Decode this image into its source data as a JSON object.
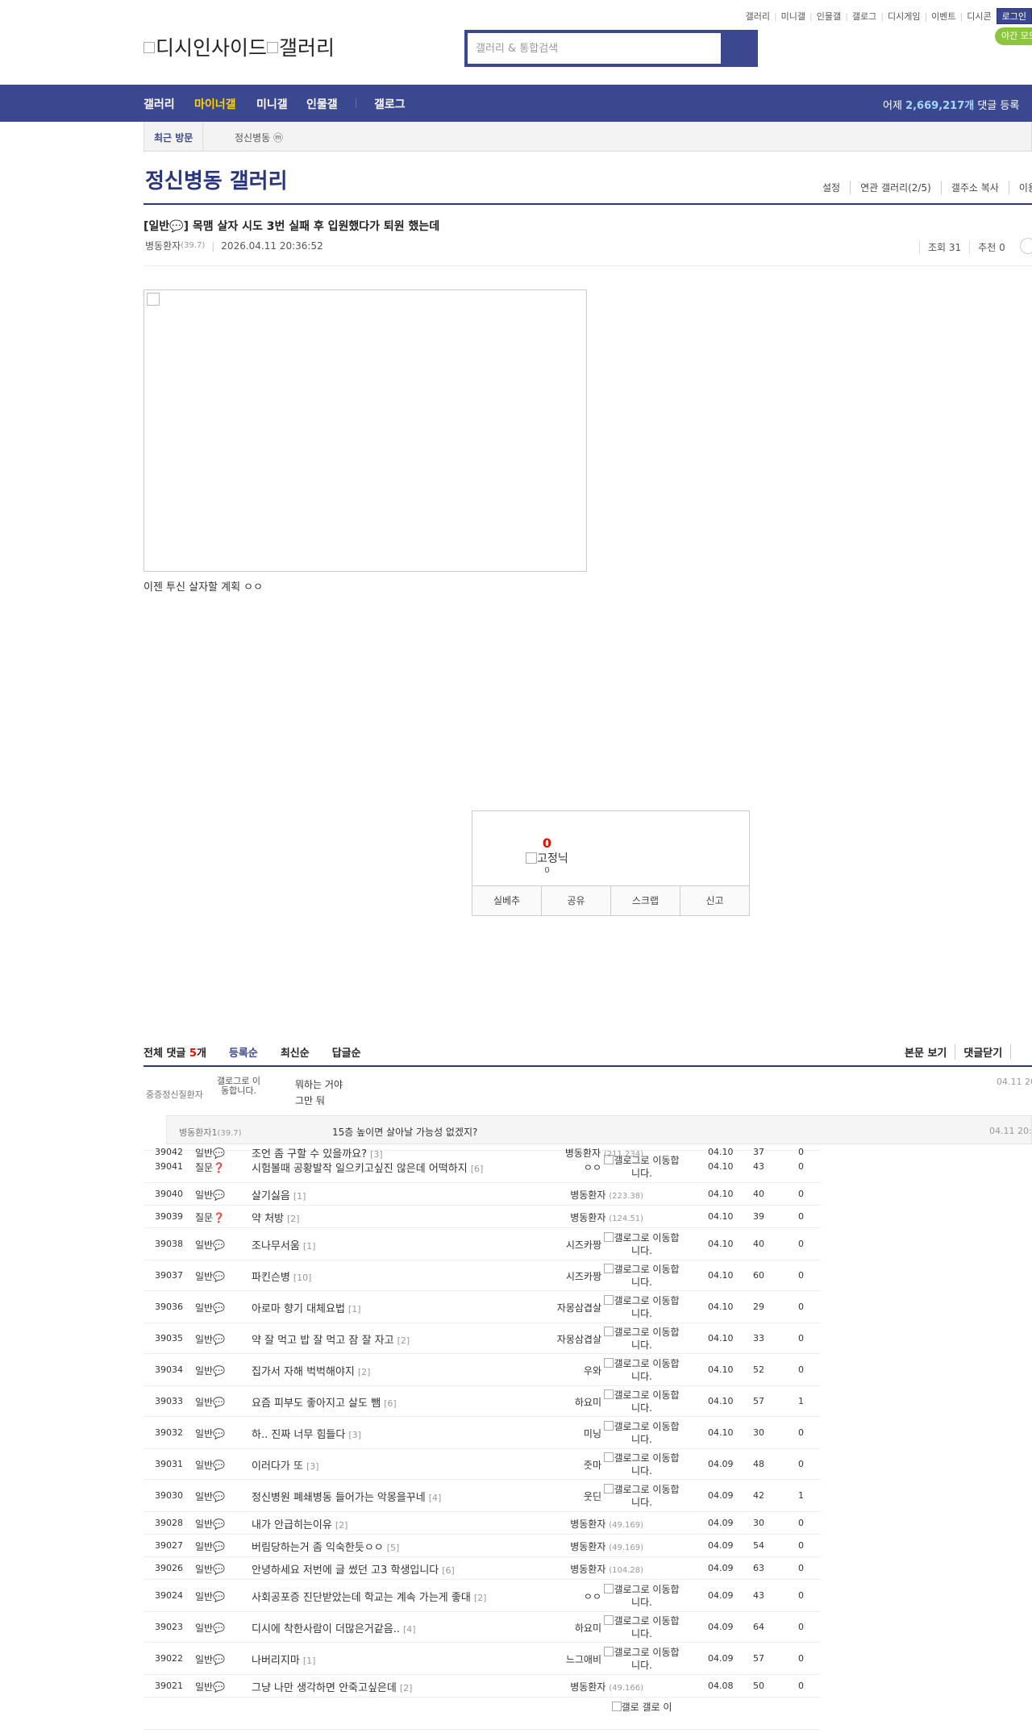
{
  "util": {
    "links": [
      "갤러리",
      "미니갤",
      "인물갤",
      "갤로그",
      "디시게임",
      "이벤트",
      "디시콘"
    ],
    "login": "로그인",
    "night": "야간 모드"
  },
  "logo": {
    "alt1": "디시인사이드",
    "alt2": "갤러리"
  },
  "search": {
    "placeholder": "갤러리 & 통합검색"
  },
  "gnb": {
    "items": [
      "갤러리",
      "마이너갤",
      "미니갤",
      "인물갤",
      "갤로그"
    ],
    "active_index": 1,
    "comment_prefix": "어제 ",
    "comment_count": "2,669,217개",
    "comment_suffix": " 댓글 등록"
  },
  "visit": {
    "label": "최근 방문",
    "gallery": "정신병동 ⓜ"
  },
  "gallery": {
    "title": "정신병동 갤러리",
    "options": [
      "설정",
      "연관 갤러리(2/5)",
      "갤주소 복사",
      "이용"
    ]
  },
  "post": {
    "title": "[일반💬] 목맴 살자 시도 3번 실패 후 입원했다가 퇴원 했는데",
    "author": "병동환자",
    "ip": "(39.7)",
    "date": "2026.04.11 20:36:52",
    "views": "조회 31",
    "recommends": "추천 0",
    "body": "이젠 투신 살자할 계획 ㅇㅇ"
  },
  "recommend": {
    "count": "0",
    "fixed_alt": "고정닉",
    "fixed_count": "0",
    "buttons": [
      "실베추",
      "공유",
      "스크랩",
      "신고"
    ]
  },
  "comments": {
    "total_label": "전체 댓글 ",
    "total_count": "5",
    "total_unit": "개",
    "tabs": [
      "등록순",
      "최신순",
      "답글순"
    ],
    "right": [
      "본문 보기",
      "댓글닫기",
      ""
    ],
    "items": [
      {
        "nick": "중증정신질환자",
        "gallog": "갤로그로 이동합니다.",
        "text1": "뭐하는 거야",
        "text2": "그만 둬",
        "date": "04.11 20"
      },
      {
        "nick": "병동환자1",
        "ip": "(39.7)",
        "text": "15층 높이면 살아날 가능성 없겠지?",
        "date": "04.11 20:4"
      }
    ]
  },
  "list": [
    {
      "no": "39042",
      "sub": "일반💬",
      "title": "조언 좀 구할 수 있을까요?",
      "rc": "[3]",
      "writer": "병동환자",
      "ip": "(211.234)",
      "date": "04.10",
      "views": "37",
      "rec": "0",
      "h": 18,
      "partial": true
    },
    {
      "no": "39041",
      "sub": "질문❓",
      "title": "시험볼때 공황발작 일으키고싶진 않은데 어떡하지",
      "rc": "[6]",
      "writer": "ㅇㅇ",
      "gallog": "갤로그로 이동합니다.",
      "date": "04.10",
      "views": "43",
      "rec": "0",
      "h": 40
    },
    {
      "no": "39040",
      "sub": "일반💬",
      "title": "살기싫음",
      "rc": "[1]",
      "writer": "병동환자",
      "ip": "(223.38)",
      "date": "04.10",
      "views": "40",
      "rec": "0",
      "h": 28
    },
    {
      "no": "39039",
      "sub": "질문❓",
      "title": "약 처방",
      "rc": "[2]",
      "writer": "병동환자",
      "ip": "(124.51)",
      "date": "04.10",
      "views": "39",
      "rec": "0",
      "h": 28
    },
    {
      "no": "39038",
      "sub": "일반💬",
      "title": "조나무서움",
      "rc": "[1]",
      "writer": "시즈카짱",
      "gallog": "갤로그로 이동합니다.",
      "date": "04.10",
      "views": "40",
      "rec": "0",
      "h": 40
    },
    {
      "no": "39037",
      "sub": "일반💬",
      "title": "파킨슨병",
      "rc": "[10]",
      "writer": "시즈카짱",
      "gallog": "갤로그로 이동합니다.",
      "date": "04.10",
      "views": "60",
      "rec": "0",
      "h": 38
    },
    {
      "no": "39036",
      "sub": "일반💬",
      "title": "아로마 향기 대체요법",
      "rc": "[1]",
      "writer": "자몽삼겹살",
      "gallog": "갤로그로 이동합니다.",
      "date": "04.10",
      "views": "29",
      "rec": "0",
      "h": 40
    },
    {
      "no": "39035",
      "sub": "일반💬",
      "title": "약 잘 먹고 밥 잘 먹고 잠 잘 자고",
      "rc": "[2]",
      "writer": "자몽삼겹살",
      "gallog": "갤로그로 이동합니다.",
      "date": "04.10",
      "views": "33",
      "rec": "0",
      "h": 38
    },
    {
      "no": "39034",
      "sub": "일반💬",
      "title": "집가서 자해 벅벅해야지",
      "rc": "[2]",
      "writer": "우와",
      "gallog": "갤로그로 이동합니다.",
      "date": "04.10",
      "views": "52",
      "rec": "0",
      "h": 40
    },
    {
      "no": "39033",
      "sub": "일반💬",
      "title": "요즘 피부도 좋아지고 살도 뺌",
      "rc": "[6]",
      "writer": "하요미",
      "gallog": "갤로그로 이동합니다.",
      "date": "04.10",
      "views": "57",
      "rec": "1",
      "h": 38
    },
    {
      "no": "39032",
      "sub": "일반💬",
      "title": "하.. 진짜 너무 힘들다",
      "rc": "[3]",
      "writer": "미닝",
      "gallog": "갤로그로 이동합니다.",
      "date": "04.10",
      "views": "30",
      "rec": "0",
      "h": 40
    },
    {
      "no": "39031",
      "sub": "일반💬",
      "title": "이러다가 또",
      "rc": "[3]",
      "writer": "줏마",
      "gallog": "갤로그로 이동합니다.",
      "date": "04.09",
      "views": "48",
      "rec": "0",
      "h": 38
    },
    {
      "no": "39030",
      "sub": "일반💬",
      "title": "정신병원 폐쇄병동 들어가는 악몽을꾸네",
      "rc": "[4]",
      "writer": "웃딘",
      "gallog": "갤로그로 이동합니다.",
      "date": "04.09",
      "views": "42",
      "rec": "1",
      "h": 40
    },
    {
      "no": "39028",
      "sub": "일반💬",
      "title": "내가 안급히는이유",
      "rc": "[2]",
      "writer": "병동환자",
      "ip": "(49.169)",
      "date": "04.09",
      "views": "30",
      "rec": "0",
      "h": 28
    },
    {
      "no": "39027",
      "sub": "일반💬",
      "title": "버림당하는거 좀 익숙한듯ㅇㅇ",
      "rc": "[5]",
      "writer": "병동환자",
      "ip": "(49.169)",
      "date": "04.09",
      "views": "54",
      "rec": "0",
      "h": 28
    },
    {
      "no": "39026",
      "sub": "일반💬",
      "title": "안녕하세요 저번에 글 썼던 고3 학생입니다",
      "rc": "[6]",
      "writer": "병동환자",
      "ip": "(104.28)",
      "date": "04.09",
      "views": "63",
      "rec": "0",
      "h": 28
    },
    {
      "no": "39024",
      "sub": "일반💬",
      "title": "사회공포증 진단받았는데 학교는 계속 가는게 좋대",
      "rc": "[2]",
      "writer": "ㅇㅇ",
      "gallog": "갤로그로 이동합니다.",
      "date": "04.09",
      "views": "43",
      "rec": "0",
      "h": 40
    },
    {
      "no": "39023",
      "sub": "일반💬",
      "title": "디시에 착한사람이 더많은거같음..",
      "rc": "[4]",
      "writer": "하요미",
      "gallog": "갤로그로 이동합니다.",
      "date": "04.09",
      "views": "64",
      "rec": "0",
      "h": 38
    },
    {
      "no": "39022",
      "sub": "일반💬",
      "title": "나버리지마",
      "rc": "[1]",
      "writer": "느그애비",
      "gallog": "갤로그로 이동합니다.",
      "date": "04.09",
      "views": "57",
      "rec": "0",
      "h": 40
    },
    {
      "no": "39021",
      "sub": "일반💬",
      "title": "그냥 나만 생각하면 안죽고싶은데",
      "rc": "[2]",
      "writer": "병동환자",
      "ip": "(49.166)",
      "date": "04.08",
      "views": "50",
      "rec": "0",
      "h": 28
    },
    {
      "no": "",
      "sub": "",
      "title": "",
      "rc": "",
      "writer": "",
      "gallog": "갤로 갤로 이",
      "date": "",
      "views": "",
      "rec": "",
      "h": 40
    }
  ]
}
